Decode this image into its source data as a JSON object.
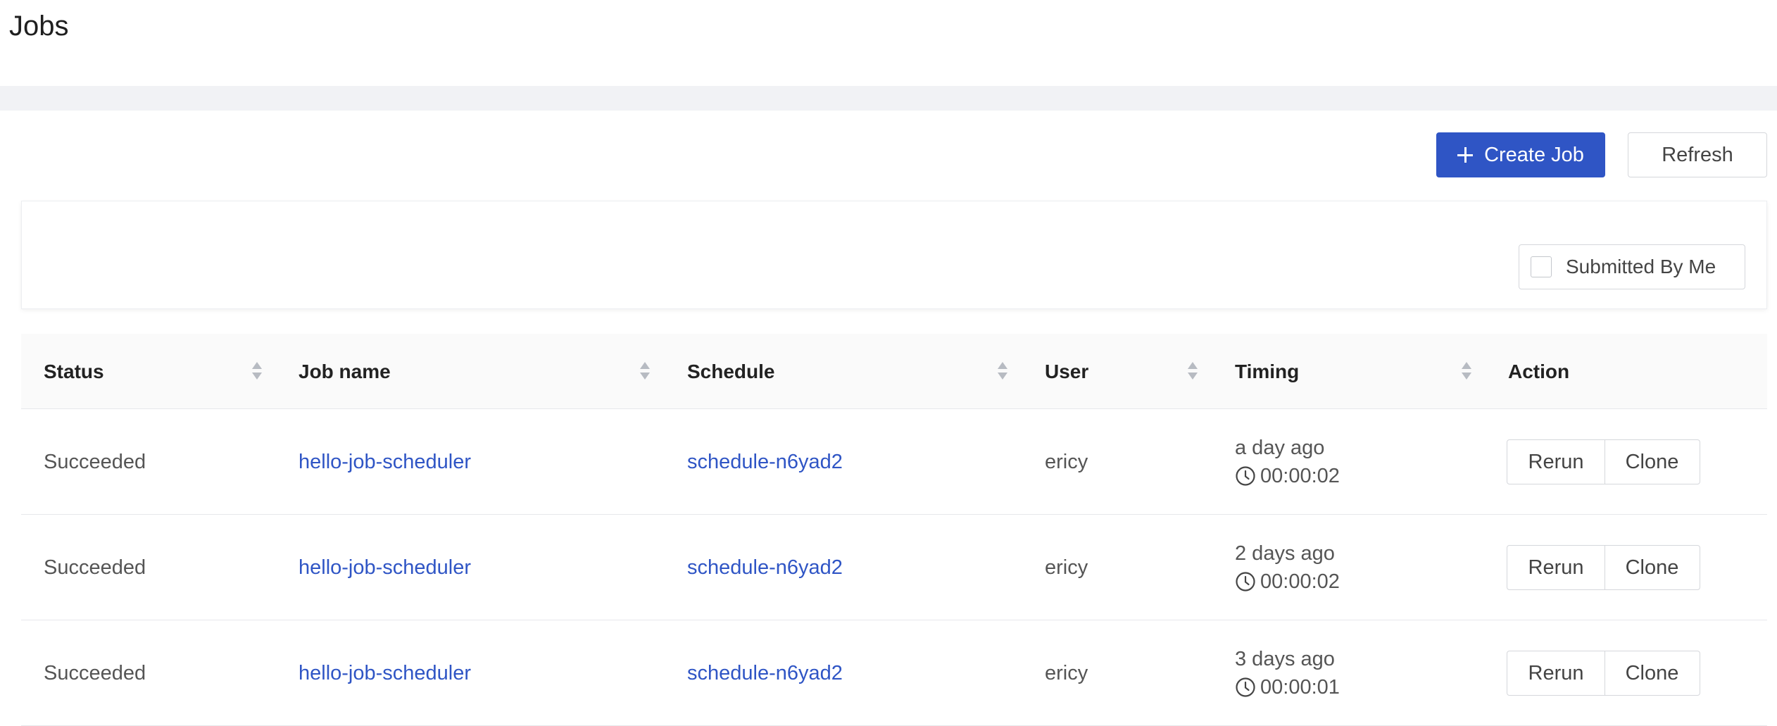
{
  "page": {
    "title": "Jobs"
  },
  "toolbar": {
    "create_label": "Create Job",
    "refresh_label": "Refresh"
  },
  "filter": {
    "submitted_by_me_label": "Submitted By Me",
    "submitted_by_me_checked": false
  },
  "table": {
    "columns": [
      "Status",
      "Job name",
      "Schedule",
      "User",
      "Timing",
      "Action"
    ],
    "rows": [
      {
        "status": "Succeeded",
        "job_name": "hello-job-scheduler",
        "schedule": "schedule-n6yad2",
        "user": "ericy",
        "timing_ago": "a day ago",
        "duration": "00:00:02",
        "rerun": "Rerun",
        "clone": "Clone"
      },
      {
        "status": "Succeeded",
        "job_name": "hello-job-scheduler",
        "schedule": "schedule-n6yad2",
        "user": "ericy",
        "timing_ago": "2 days ago",
        "duration": "00:00:02",
        "rerun": "Rerun",
        "clone": "Clone"
      },
      {
        "status": "Succeeded",
        "job_name": "hello-job-scheduler",
        "schedule": "schedule-n6yad2",
        "user": "ericy",
        "timing_ago": "3 days ago",
        "duration": "00:00:01",
        "rerun": "Rerun",
        "clone": "Clone"
      }
    ]
  },
  "colors": {
    "primary": "#2f55c5",
    "link": "#2f55c5",
    "header_band": "#f1f2f5"
  },
  "icons": {
    "create": "plus-icon",
    "sort": "sort-icon",
    "duration": "clock-icon",
    "checkbox": "checkbox-icon"
  }
}
